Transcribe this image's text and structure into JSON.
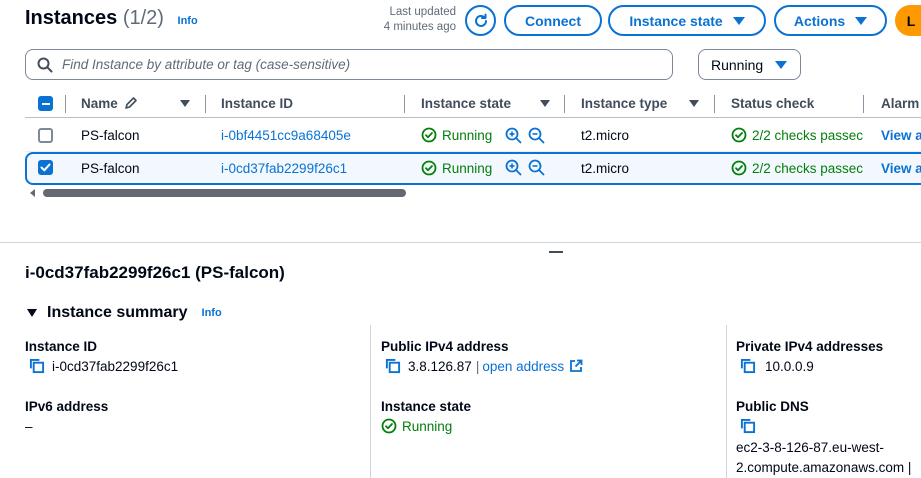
{
  "header": {
    "title": "Instances",
    "count": "(1/2)",
    "info": "Info",
    "last_updated_line1": "Last updated",
    "last_updated_line2": "4 minutes ago",
    "connect": "Connect",
    "instance_state": "Instance state",
    "actions": "Actions",
    "launch": "L"
  },
  "search": {
    "placeholder": "Find Instance by attribute or tag (case-sensitive)"
  },
  "filter": {
    "selected": "Running"
  },
  "table": {
    "columns": [
      "Name",
      "Instance ID",
      "Instance state",
      "Instance type",
      "Status check",
      "Alarm"
    ],
    "rows": [
      {
        "name": "PS-falcon",
        "instance_id": "i-0bf4451cc9a68405e",
        "state": "Running",
        "type": "t2.micro",
        "status_check": "2/2 checks passec",
        "alarm": "View a",
        "selected": false
      },
      {
        "name": "PS-falcon",
        "instance_id": "i-0cd37fab2299f26c1",
        "state": "Running",
        "type": "t2.micro",
        "status_check": "2/2 checks passec",
        "alarm": "View a",
        "selected": true
      }
    ]
  },
  "details": {
    "title": "i-0cd37fab2299f26c1 (PS-falcon)",
    "summary_heading": "Instance summary",
    "summary_info": "Info",
    "instance_id_label": "Instance ID",
    "instance_id": "i-0cd37fab2299f26c1",
    "ipv6_label": "IPv6 address",
    "ipv6": "–",
    "public_ipv4_label": "Public IPv4 address",
    "public_ipv4": "3.8.126.87",
    "separator": "|",
    "open_address": "open address",
    "instance_state_label": "Instance state",
    "instance_state": "Running",
    "private_ipv4_label": "Private IPv4 addresses",
    "private_ipv4": "10.0.0.9",
    "public_dns_label": "Public DNS",
    "public_dns_line1": "ec2-3-8-126-87.eu-west-",
    "public_dns_line2": "2.compute.amazonaws.com |"
  },
  "colors": {
    "link": "#0972d3",
    "success": "#037f0c",
    "primary": "#ff9900",
    "text": "#000716"
  },
  "icons": [
    "refresh-icon",
    "search-icon",
    "pencil-icon",
    "check-circle-icon",
    "zoom-in-icon",
    "zoom-out-icon",
    "copy-icon",
    "external-link-icon",
    "checkmark-icon"
  ]
}
